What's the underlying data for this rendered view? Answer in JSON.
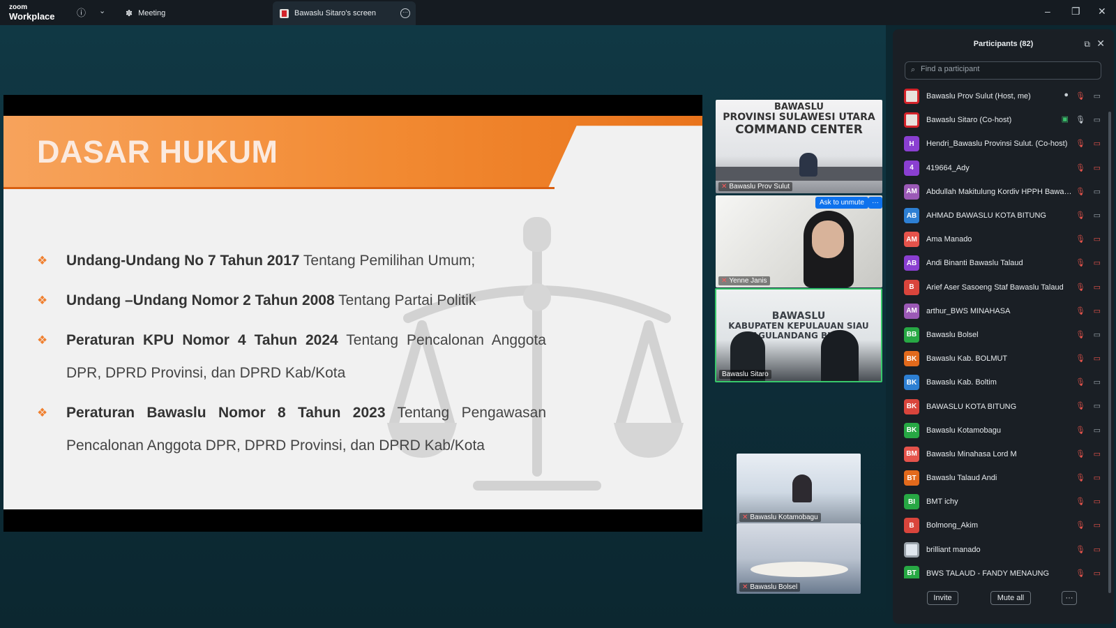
{
  "app": {
    "logo_top": "zoom",
    "logo_bottom": "Workplace",
    "meeting_tab": "Meeting",
    "screen_tab": "Bawaslu Sitaro's screen"
  },
  "slide": {
    "title": "DASAR HUKUM",
    "items": [
      {
        "bold": "Undang-Undang No 7 Tahun 2017",
        "rest": " Tentang Pemilihan Umum;"
      },
      {
        "bold": "Undang –Undang Nomor 2 Tahun 2008",
        "rest": " Tentang Partai Politik"
      },
      {
        "bold": "Peraturan KPU Nomor 4 Tahun 2024",
        "rest": " Tentang Pencalonan Anggota DPR, DPRD Provinsi, dan DPRD Kab/Kota"
      },
      {
        "bold": "Peraturan Bawaslu Nomor 8 Tahun 2023",
        "rest": " Tentang Pengawasan Pencalonan Anggota DPR, DPRD Provinsi, dan DPRD Kab/Kota"
      }
    ]
  },
  "videos": {
    "tile1": {
      "name": "Bawaslu Prov Sulut",
      "sign_a": "BAWASLU",
      "sign_b": "PROVINSI SULAWESI UTARA",
      "sign_c": "COMMAND CENTER"
    },
    "tile2": {
      "name": "Yenne Janis",
      "ask_unmute": "Ask to unmute",
      "more": "···"
    },
    "tile3": {
      "name": "Bawaslu Sitaro",
      "sign_a": "BAWASLU",
      "sign_b": "KABUPATEN KEPULAUAN SIAU TAGULANDANG BIARO"
    },
    "tile4": {
      "name": "Bawaslu Kotamobagu"
    },
    "tile5": {
      "name": "Bawaslu Bolsel"
    }
  },
  "panel": {
    "title": "Participants (82)",
    "search_placeholder": "Find a participant",
    "invite": "Invite",
    "mute_all": "Mute all",
    "more": "···",
    "participants": [
      {
        "initials": "",
        "color": "#e8e1dd",
        "name": "Bawaslu Prov Sulut (Host, me)",
        "mic_on": false,
        "cam_on": true,
        "extra": "●"
      },
      {
        "initials": "",
        "color": "#e8e1dd",
        "name": "Bawaslu Sitaro (Co-host)",
        "mic_on": true,
        "cam_on": true,
        "extra": "▣"
      },
      {
        "initials": "H",
        "color": "#8a3fd1",
        "name": "Hendri_Bawaslu Provinsi Sulut. (Co-host)",
        "mic_on": false,
        "cam_on": false,
        "extra": ""
      },
      {
        "initials": "4",
        "color": "#8a3fd1",
        "name": "419664_Ady",
        "mic_on": false,
        "cam_on": false,
        "extra": ""
      },
      {
        "initials": "AM",
        "color": "#9b59b6",
        "name": "Abdullah Makitulung Kordiv HPPH Bawaslu",
        "mic_on": false,
        "cam_on": true,
        "extra": ""
      },
      {
        "initials": "AB",
        "color": "#2d7fd3",
        "name": "AHMAD BAWASLU KOTA BITUNG",
        "mic_on": false,
        "cam_on": true,
        "extra": ""
      },
      {
        "initials": "AM",
        "color": "#e5534b",
        "name": "Ama Manado",
        "mic_on": false,
        "cam_on": false,
        "extra": ""
      },
      {
        "initials": "AB",
        "color": "#8a3fd1",
        "name": "Andi Binanti Bawaslu Talaud",
        "mic_on": false,
        "cam_on": false,
        "extra": ""
      },
      {
        "initials": "B",
        "color": "#d9453c",
        "name": "Arief Aser Sasoeng Staf Bawaslu Talaud",
        "mic_on": false,
        "cam_on": false,
        "extra": ""
      },
      {
        "initials": "AM",
        "color": "#9b59b6",
        "name": "arthur_BWS MINAHASA",
        "mic_on": false,
        "cam_on": false,
        "extra": ""
      },
      {
        "initials": "BB",
        "color": "#27a844",
        "name": "Bawaslu Bolsel",
        "mic_on": false,
        "cam_on": true,
        "extra": ""
      },
      {
        "initials": "BK",
        "color": "#e26a1c",
        "name": "Bawaslu Kab. BOLMUT",
        "mic_on": false,
        "cam_on": false,
        "extra": ""
      },
      {
        "initials": "BK",
        "color": "#2d7fd3",
        "name": "Bawaslu Kab. Boltim",
        "mic_on": false,
        "cam_on": true,
        "extra": ""
      },
      {
        "initials": "BK",
        "color": "#d9453c",
        "name": "BAWASLU KOTA BITUNG",
        "mic_on": false,
        "cam_on": true,
        "extra": ""
      },
      {
        "initials": "BK",
        "color": "#27a844",
        "name": "Bawaslu Kotamobagu",
        "mic_on": false,
        "cam_on": true,
        "extra": ""
      },
      {
        "initials": "BM",
        "color": "#e5534b",
        "name": "Bawaslu Minahasa Lord M",
        "mic_on": false,
        "cam_on": false,
        "extra": ""
      },
      {
        "initials": "BT",
        "color": "#e26a1c",
        "name": "Bawaslu Talaud Andi",
        "mic_on": false,
        "cam_on": false,
        "extra": ""
      },
      {
        "initials": "BI",
        "color": "#27a844",
        "name": "BMT ichy",
        "mic_on": false,
        "cam_on": false,
        "extra": ""
      },
      {
        "initials": "B",
        "color": "#d9453c",
        "name": "Bolmong_Akim",
        "mic_on": false,
        "cam_on": false,
        "extra": ""
      },
      {
        "initials": "",
        "color": "#dfe6ee",
        "name": "brilliant manado",
        "mic_on": false,
        "cam_on": false,
        "extra": ""
      },
      {
        "initials": "BT",
        "color": "#27a844",
        "name": "BWS TALAUD - FANDY MENAUNG",
        "mic_on": false,
        "cam_on": false,
        "extra": ""
      }
    ]
  }
}
